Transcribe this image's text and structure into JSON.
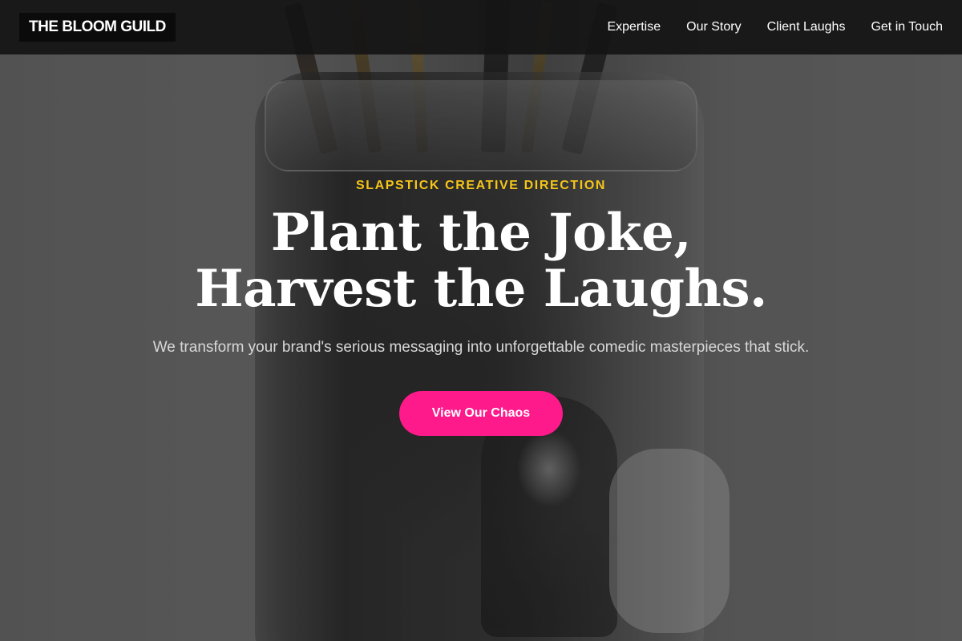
{
  "nav": {
    "logo": "THE BLOOM GUILD",
    "links": [
      "Expertise",
      "Our Story",
      "Client Laughs",
      "Get in Touch"
    ]
  },
  "hero": {
    "eyebrow": "SLAPSTICK CREATIVE DIRECTION",
    "headline_line1": "Plant the Joke,",
    "headline_line2": "Harvest the Laughs.",
    "subtext": "We transform your brand's serious messaging into unforgettable comedic masterpieces that stick.",
    "cta_label": "View Our Chaos"
  },
  "colors": {
    "accent": "#ff1a8c",
    "eyebrow": "#f5c518",
    "nav_bg": "#141414"
  }
}
